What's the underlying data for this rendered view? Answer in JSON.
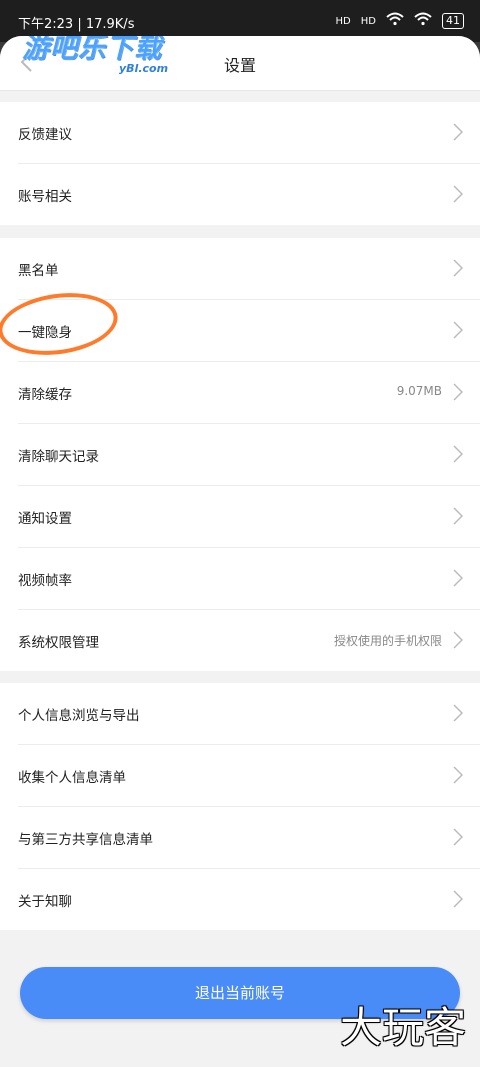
{
  "status_bar": {
    "time": "下午2:23 | 17.9K/s",
    "signal1": "HD",
    "signal2": "HD",
    "battery": "41"
  },
  "header": {
    "title": "设置",
    "back_icon": "chevron-left-icon"
  },
  "watermark": {
    "main": "游吧乐下载",
    "sub": "yBl.com",
    "corner": "大玩客"
  },
  "groups": [
    {
      "items": [
        {
          "label": "反馈建议",
          "value": ""
        },
        {
          "label": "账号相关",
          "value": ""
        }
      ]
    },
    {
      "items": [
        {
          "label": "黑名单",
          "value": ""
        },
        {
          "label": "一键隐身",
          "value": ""
        },
        {
          "label": "清除缓存",
          "value": "9.07MB"
        },
        {
          "label": "清除聊天记录",
          "value": ""
        },
        {
          "label": "通知设置",
          "value": ""
        },
        {
          "label": "视频帧率",
          "value": ""
        },
        {
          "label": "系统权限管理",
          "value": "授权使用的手机权限"
        }
      ]
    },
    {
      "items": [
        {
          "label": "个人信息浏览与导出",
          "value": ""
        },
        {
          "label": "收集个人信息清单",
          "value": ""
        },
        {
          "label": "与第三方共享信息清单",
          "value": ""
        },
        {
          "label": "关于知聊",
          "value": ""
        }
      ]
    }
  ],
  "logout_button": "退出当前账号",
  "colors": {
    "accent": "#4a8cf7",
    "highlight_circle": "#ff7a2a",
    "background": "#f2f2f2"
  }
}
